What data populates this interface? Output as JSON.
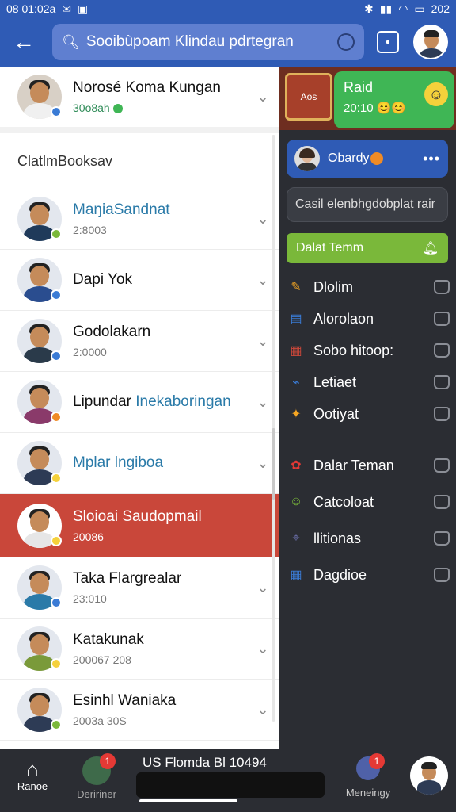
{
  "status_bar": {
    "time": "08 01:02a",
    "right_text": "202"
  },
  "search": {
    "placeholder": "Sooibùpoam Klindau pdrtegran"
  },
  "pinned_contact": {
    "name": "Norosé Koma Kungan",
    "sub": "30o8ah"
  },
  "section_title": "ClatlmBooksav",
  "contacts": [
    {
      "name": "MaŋiaSandnat",
      "sub": "2:8003",
      "dot": "#7ab83a",
      "shirt": "#1f3a5a"
    },
    {
      "name": "Dapi Yok",
      "sub": "",
      "dot": "#3a7bd5",
      "shirt": "#2a4d8f"
    },
    {
      "name": "Godolakarn",
      "sub": "2:0000",
      "dot": "#3a7bd5",
      "shirt": "#2a3a4a"
    },
    {
      "name_a": "Lipundar ",
      "name_b": "Inekaboringan",
      "sub": "",
      "dot": "#f08b25",
      "shirt": "#8a3a6a"
    },
    {
      "name": "Mplar lngiboa",
      "sub": "",
      "dot": "#f5d13b",
      "shirt": "#2d3b55"
    },
    {
      "name": "Sloioai Saudopmail",
      "sub": "20086",
      "dot": "#f5d13b",
      "shirt": "#e6e6e6",
      "active": true
    },
    {
      "name": "Taka Flargrealar",
      "sub": "23:010",
      "dot": "#3a7bd5",
      "shirt": "#2a7aa8"
    },
    {
      "name": "Katakunak",
      "sub": "200067 208",
      "dot": "#f5d13b",
      "shirt": "#7a9a3a"
    },
    {
      "name": "Esinhl Waniaka",
      "sub": "2003a 30S",
      "dot": "#7ab83a",
      "shirt": "#2d3b55"
    }
  ],
  "right_panel": {
    "tv_label": "Aos",
    "notification": {
      "title": "Raid",
      "time": "20:10"
    },
    "user": {
      "name": "Obardy"
    },
    "compose_placeholder": "Casil elenbhgdobplat rair",
    "group_label": "Dalat Temm",
    "menu": [
      {
        "label": "Dlolim",
        "icon": "pencil-icon",
        "color": "#f5a623"
      },
      {
        "label": "Alorolaon",
        "icon": "book-icon",
        "color": "#3a7bd5"
      },
      {
        "label": "Sobo hitoop:",
        "icon": "calendar-icon",
        "color": "#c9473a"
      },
      {
        "label": "Letiaet",
        "icon": "tag-icon",
        "color": "#3a7bd5"
      },
      {
        "label": "Ootiyat",
        "icon": "ticket-icon",
        "color": "#f5a623"
      },
      {
        "label": "Dalar Teman",
        "icon": "flower-icon",
        "color": "#e53935"
      },
      {
        "label": "Catcoloat",
        "icon": "person-icon",
        "color": "#7ab83a"
      },
      {
        "label": "llitionas",
        "icon": "pin-icon",
        "color": "#6a6ea8"
      },
      {
        "label": "Dagdioe",
        "icon": "grid-icon",
        "color": "#3a7bd5"
      }
    ]
  },
  "bottom_nav": {
    "home_label": "Ranoe",
    "d_label": "Deririner",
    "d_badge": "1",
    "mini_status": "US Flomda Bl 10494",
    "m_label": "Meneingy",
    "m_badge": "1"
  }
}
